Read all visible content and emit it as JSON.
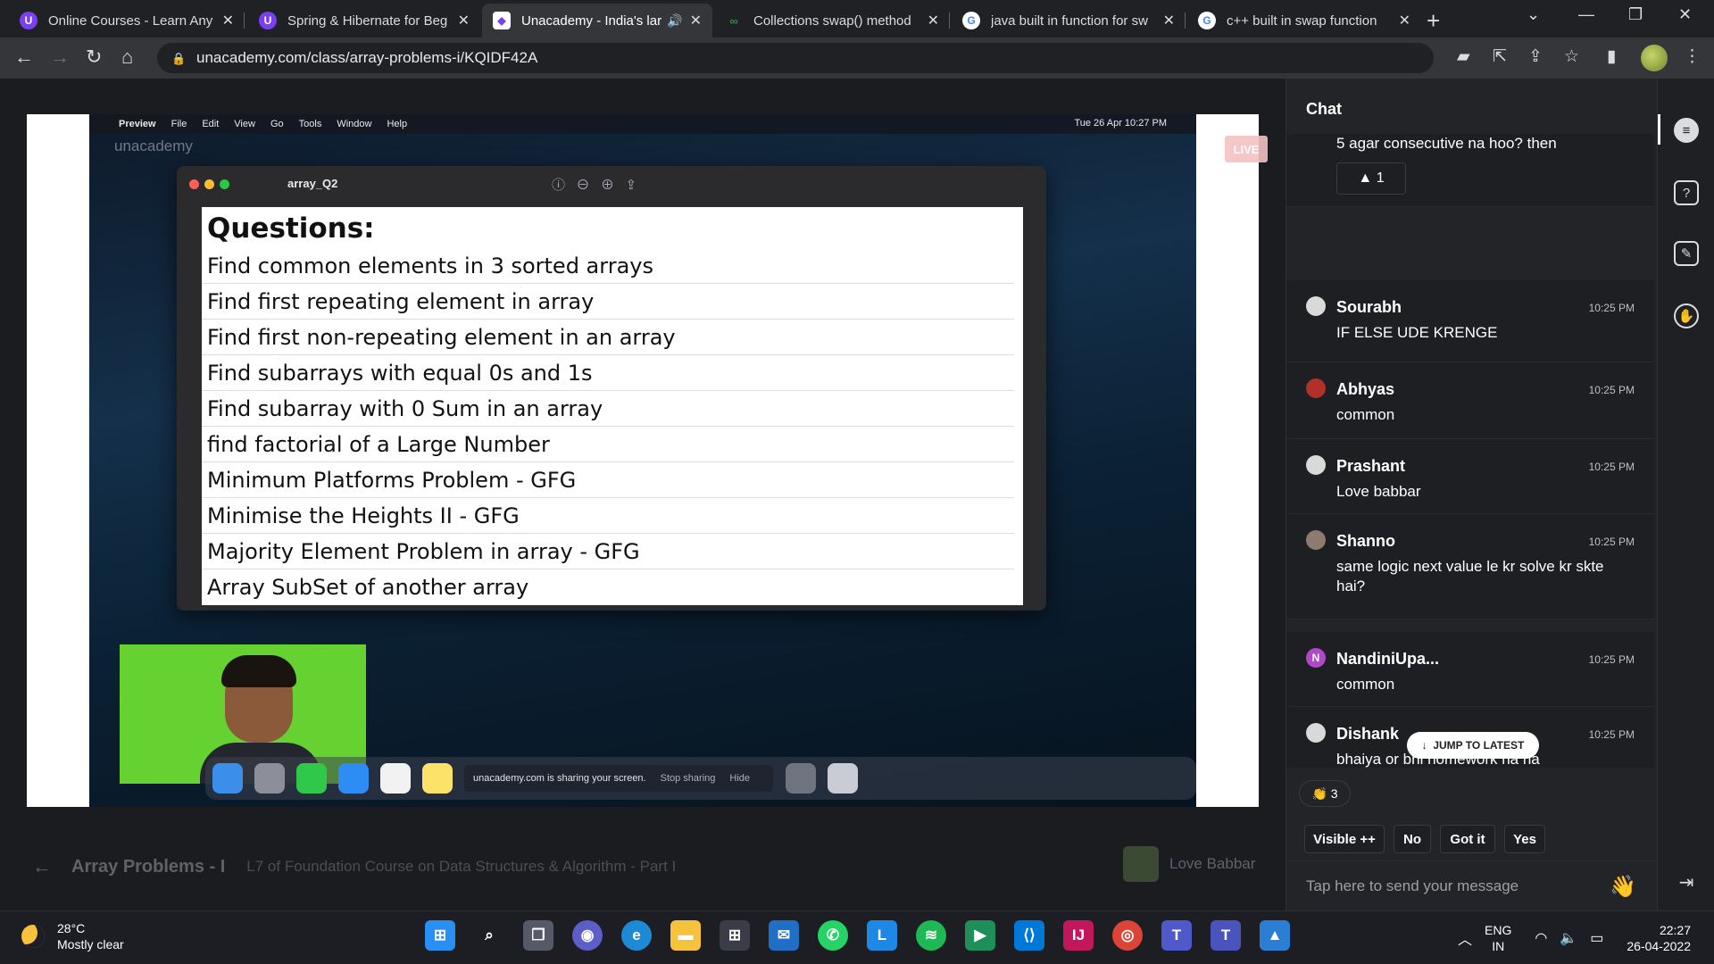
{
  "browser": {
    "tabs": [
      {
        "title": "Online Courses - Learn Any",
        "favicon": "unacademy-icon",
        "active": false
      },
      {
        "title": "Spring & Hibernate for Beg",
        "favicon": "unacademy-icon",
        "active": false
      },
      {
        "title": "Unacademy - India's lar",
        "favicon": "unacademy-icon",
        "active": true,
        "audio": "speaker-icon"
      },
      {
        "title": "Collections swap() method",
        "favicon": "gfg-icon",
        "active": false
      },
      {
        "title": "java built in function for sw",
        "favicon": "google-icon",
        "active": false
      },
      {
        "title": "c++ built in swap function",
        "favicon": "google-icon",
        "active": false
      }
    ],
    "url": "unacademy.com/class/array-problems-i/KQIDF42A"
  },
  "shared_screen": {
    "watermark": "unacademy",
    "live_badge": "LIVE",
    "mac_menubar": {
      "app": "Preview",
      "menus": [
        "File",
        "Edit",
        "View",
        "Go",
        "Tools",
        "Window",
        "Help"
      ],
      "clock": "Tue 26 Apr  10:27 PM"
    },
    "preview_window_title": "array_Q2",
    "slide": {
      "heading": "Questions:",
      "items": [
        "Find common elements in 3 sorted arrays",
        "Find first repeating element in array",
        "Find first non-repeating element in an array",
        "Find subarrays with equal 0s and 1s",
        "Find subarray with 0 Sum in an array",
        "find factorial of a Large Number",
        "Minimum Platforms Problem - GFG",
        "Minimise the Heights II - GFG",
        "Majority Element Problem in array - GFG",
        "Array SubSet of another array"
      ]
    },
    "sharing_bar": {
      "text": "unacademy.com is sharing your screen.",
      "stop": "Stop sharing",
      "hide": "Hide"
    }
  },
  "video_footer": {
    "class_title": "Array Problems - I",
    "subtitle": "L7 of Foundation Course on Data Structures & Algorithm - Part I",
    "teacher": "Love Babbar"
  },
  "chat": {
    "header": "Chat",
    "pinned": {
      "text": "5 agar consecutive na hoo? then",
      "upvotes": "1"
    },
    "messages": [
      {
        "name": "Sourabh",
        "time": "10:25 PM",
        "text": "IF ELSE UDE KRENGE"
      },
      {
        "name": "Abhyas",
        "time": "10:25 PM",
        "text": "common"
      },
      {
        "name": "Prashant",
        "time": "10:25 PM",
        "text": "Love babbar"
      },
      {
        "name": "Shanno",
        "time": "10:25 PM",
        "text": "same logic next value le kr solve kr skte hai?"
      },
      {
        "name": "NandiniUpa...",
        "time": "10:25 PM",
        "text": "common",
        "initial": "N"
      },
      {
        "name": "Dishank",
        "time": "10:25 PM",
        "text": "bhaiya or bhi homework ha na"
      }
    ],
    "jump_latest": "JUMP TO LATEST",
    "reaction_count": "3",
    "quick_replies": [
      "Visible ++",
      "No",
      "Got it",
      "Yes"
    ],
    "input_placeholder": "Tap here to send your message"
  },
  "taskbar": {
    "temperature": "28°C",
    "weather": "Mostly clear",
    "lang_top": "ENG",
    "lang_bottom": "IN",
    "time": "22:27",
    "date": "26-04-2022"
  },
  "colors": {
    "accent": "#08bd80",
    "live": "#f4c2c2",
    "webcam_bg": "#66d231"
  }
}
